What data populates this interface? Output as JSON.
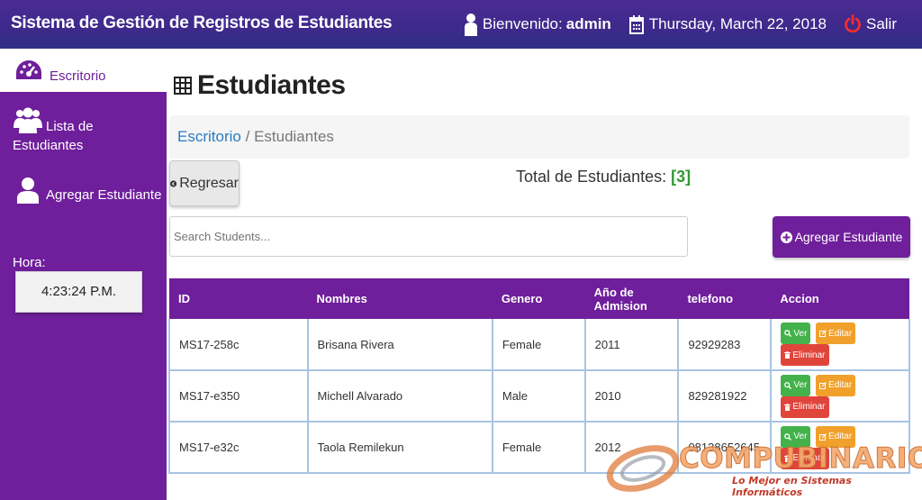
{
  "header": {
    "title": "Sistema de Gestión de Registros de Estudiantes",
    "welcome_prefix": "Bienvenido:",
    "user": "admin",
    "date": "Thursday, March 22, 2018",
    "logout": "Salir"
  },
  "sidebar": {
    "items": [
      {
        "label": "Escritorio",
        "icon": "dashboard-icon",
        "active": true
      },
      {
        "label": "Lista de Estudiantes",
        "icon": "users-icon"
      },
      {
        "label": "Agregar Estudiante",
        "icon": "user-icon"
      }
    ],
    "hora_label": "Hora:",
    "time": "4:23:24 P.M."
  },
  "main": {
    "title": "Estudiantes",
    "breadcrumb": {
      "link": "Escritorio",
      "separator": "/",
      "current": "Estudiantes"
    },
    "back_label": "Regresar",
    "total_label": "Total de Estudiantes:",
    "total_value": "[3]",
    "search_placeholder": "Search Students...",
    "add_label": "Agregar Estudiante"
  },
  "table": {
    "headers": [
      "ID",
      "Nombres",
      "Genero",
      "Año de Admision",
      "telefono",
      "Accion"
    ],
    "rows": [
      {
        "id": "MS17-258c",
        "name": "Brisana Rivera",
        "gender": "Female",
        "year": "2011",
        "phone": "92929283"
      },
      {
        "id": "MS17-e350",
        "name": "Michell Alvarado",
        "gender": "Male",
        "year": "2010",
        "phone": "829281922"
      },
      {
        "id": "MS17-e32c",
        "name": "Taola Remilekun",
        "gender": "Female",
        "year": "2012",
        "phone": "08138652645"
      }
    ],
    "actions": {
      "view": "Ver",
      "edit": "Editar",
      "delete": "Eliminar"
    }
  },
  "watermark": {
    "brand": "COMPUBINARIO",
    "tagline": "Lo Mejor en Sistemas Informáticos"
  },
  "colors": {
    "header": "#3d2a8a",
    "sidebar": "#6f1f9b",
    "view": "#43b24b",
    "edit": "#f0a02b",
    "delete": "#e0453c"
  }
}
